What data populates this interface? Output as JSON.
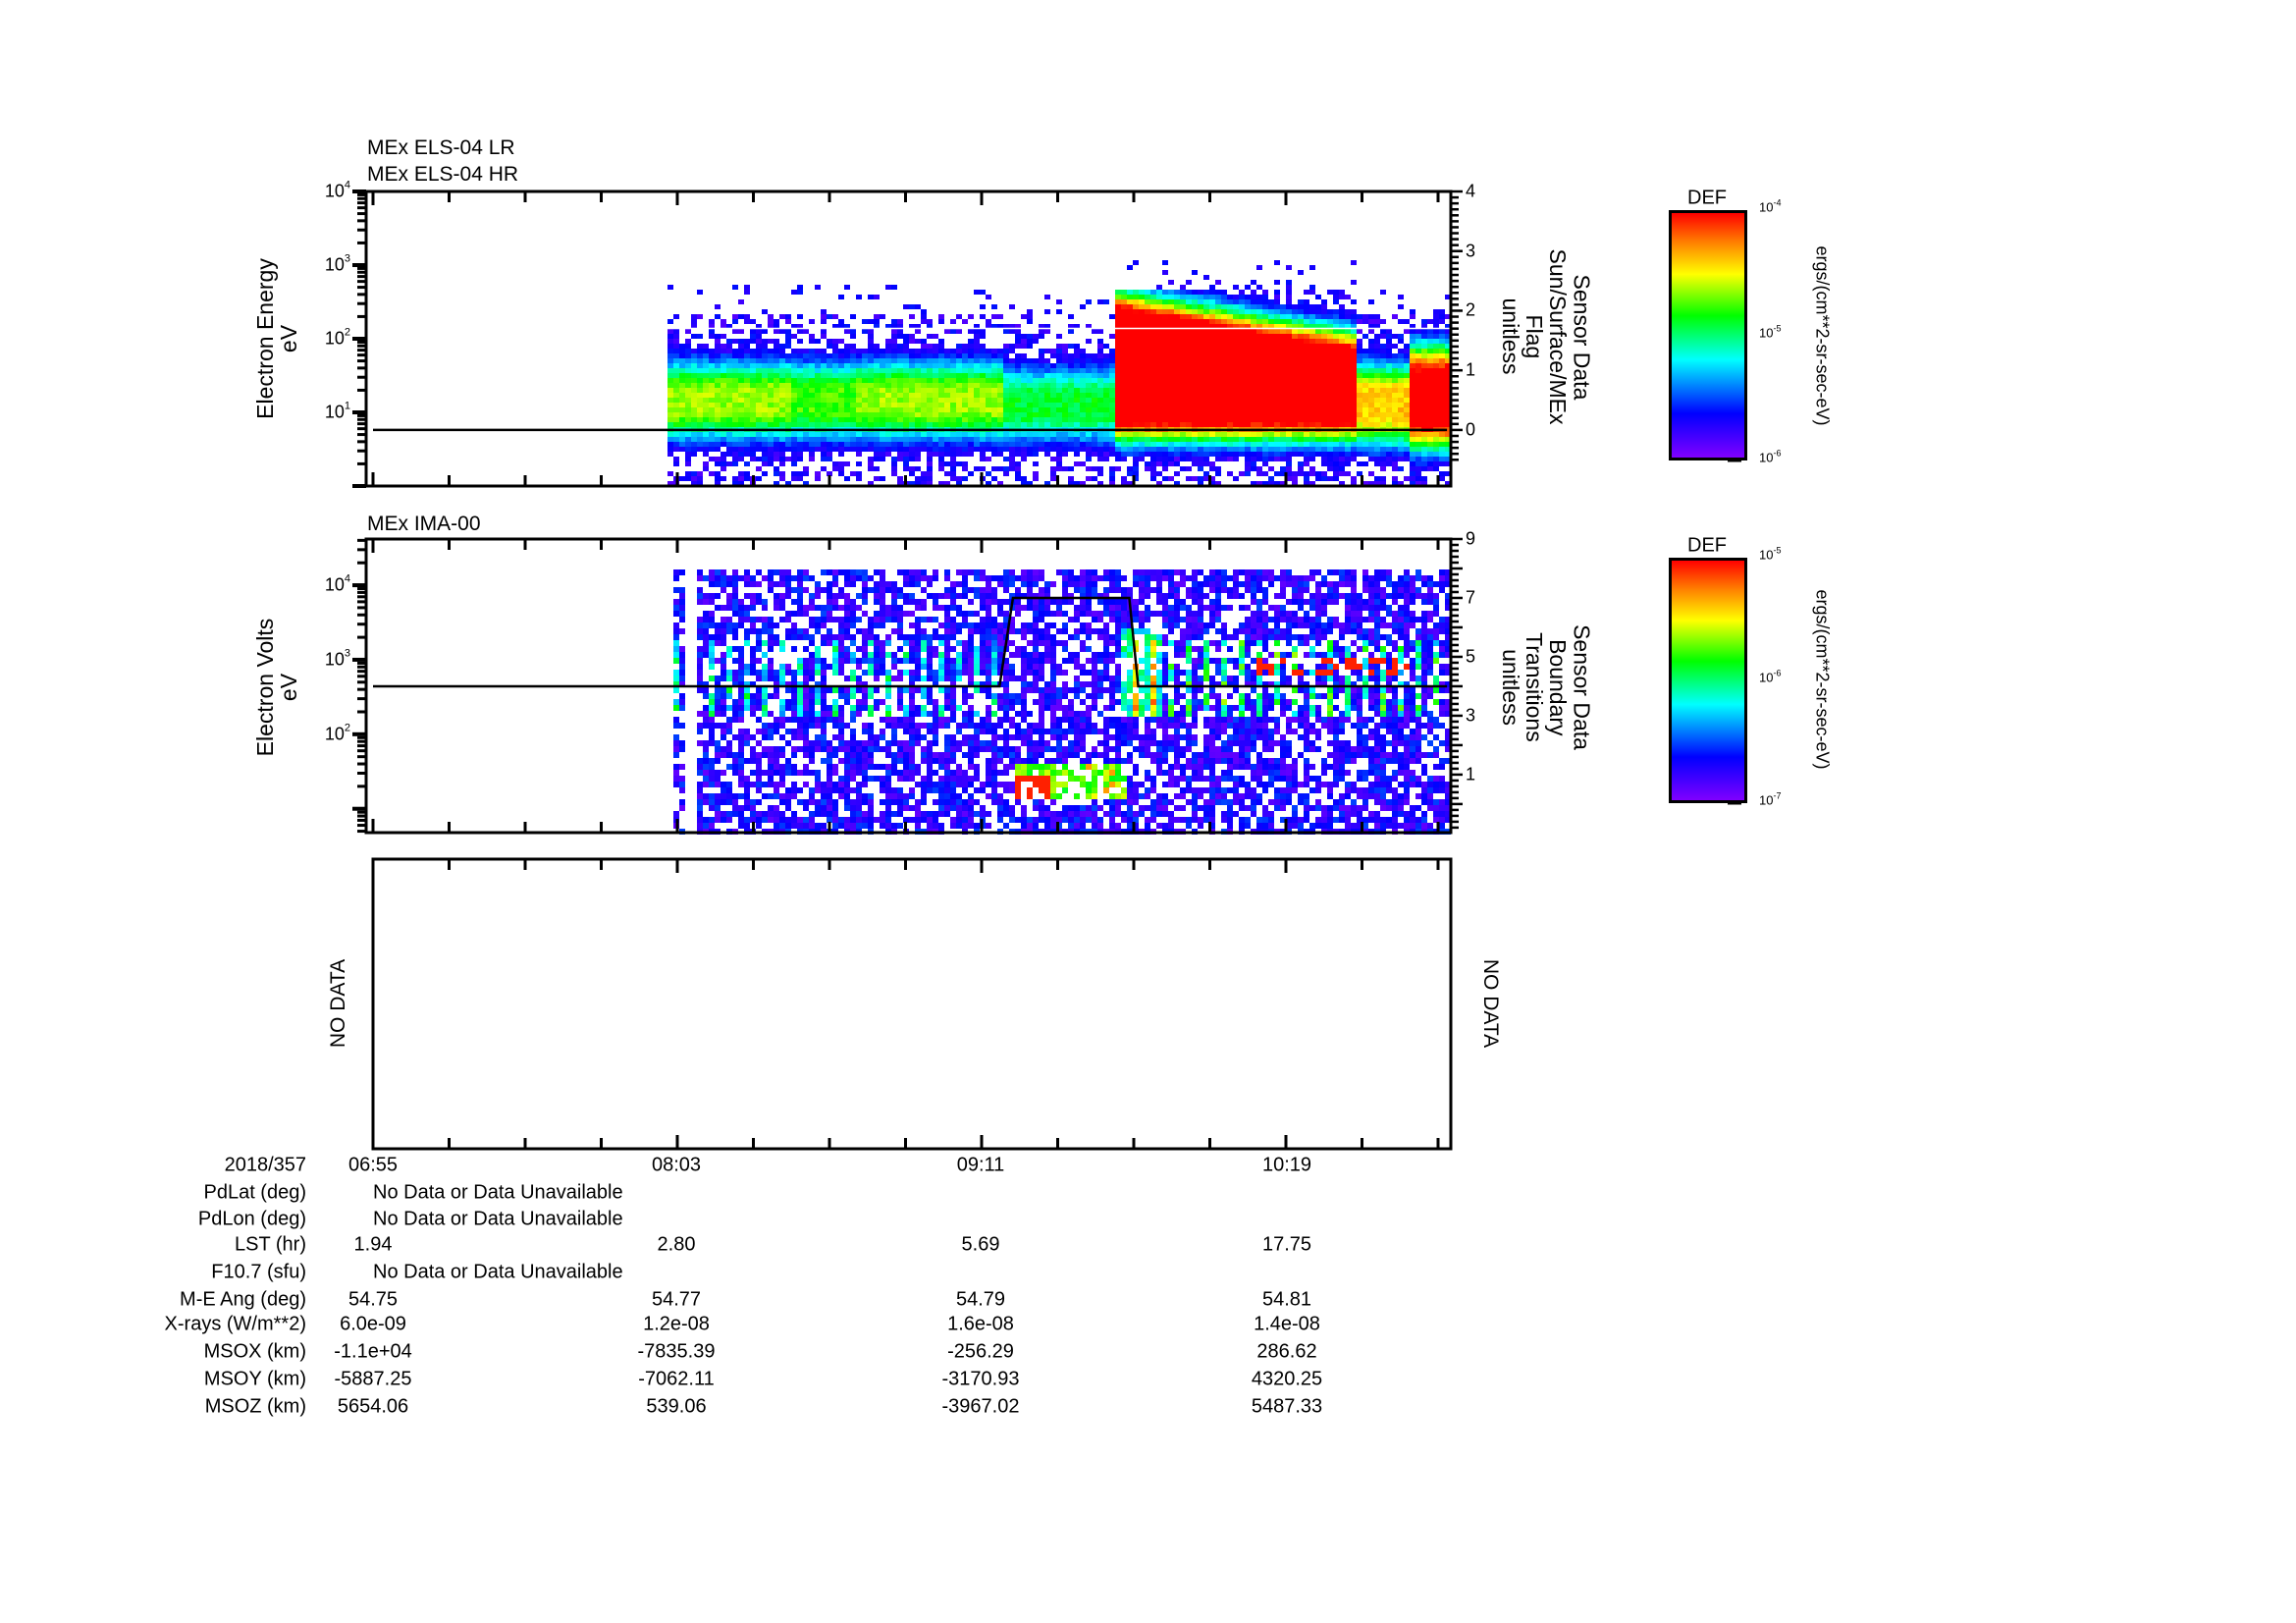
{
  "colormap": [
    "#8000ff",
    "#0000ff",
    "#00ffff",
    "#00ff00",
    "#ffff00",
    "#ff8000",
    "#ff0000"
  ],
  "chart_data": [
    {
      "type": "heatmap",
      "titles": [
        "MEx ELS-04 LR",
        "MEx ELS-04 HR"
      ],
      "ylabel": [
        "Electron Energy",
        "eV"
      ],
      "y_scale": "log",
      "ylim": [
        1,
        10000
      ],
      "y_ticks": [
        {
          "base": "10",
          "exp": "1"
        },
        {
          "base": "10",
          "exp": "2"
        },
        {
          "base": "10",
          "exp": "3"
        },
        {
          "base": "10",
          "exp": "4"
        }
      ],
      "xlim": [
        "06:55",
        "10:55"
      ],
      "x_ticks": [
        "06:55",
        "08:03",
        "09:11",
        "10:19"
      ],
      "right_axis": {
        "label": [
          "Sensor Data",
          "Sun/Surface/MEx",
          "Flag",
          "unitless"
        ],
        "ylim": [
          -0.94,
          4
        ],
        "ticks": [
          "0",
          "1",
          "2",
          "3",
          "4"
        ]
      },
      "overlay": {
        "line_color": "#000000",
        "points": [
          [
            "06:55",
            0
          ],
          [
            "10:55",
            0
          ]
        ]
      },
      "colorbar": {
        "title": "DEF",
        "scale": "log",
        "range": [
          1e-06,
          0.0001
        ],
        "ticks": [
          {
            "base": "10",
            "exp": "-4"
          },
          {
            "base": "10",
            "exp": "-5"
          },
          {
            "base": "10",
            "exp": "-6"
          }
        ],
        "units": "ergs/(cm**2-sr-sec-eV)"
      }
    },
    {
      "type": "heatmap",
      "titles": [
        "MEx IMA-00"
      ],
      "ylabel": [
        "Electron Volts",
        "eV"
      ],
      "y_scale": "log",
      "ylim": [
        4.8,
        41700
      ],
      "y_ticks": [
        {
          "base": "10",
          "exp": "2"
        },
        {
          "base": "10",
          "exp": "3"
        },
        {
          "base": "10",
          "exp": "4"
        }
      ],
      "xlim": [
        "06:55",
        "10:55"
      ],
      "x_ticks": [
        "06:55",
        "08:03",
        "09:11",
        "10:19"
      ],
      "right_axis": {
        "label": [
          "Sensor Data",
          "Boundary",
          "Transitions",
          "unitless"
        ],
        "ylim": [
          -0.97,
          9
        ],
        "ticks": [
          "1",
          "3",
          "5",
          "7",
          "9"
        ]
      },
      "overlay": {
        "line_color": "#000000",
        "points": [
          [
            "06:55",
            4
          ],
          [
            "09:15",
            4
          ],
          [
            "09:18",
            7
          ],
          [
            "09:44",
            7
          ],
          [
            "09:46",
            4
          ],
          [
            "10:55",
            4
          ]
        ]
      },
      "colorbar": {
        "title": "DEF",
        "scale": "log",
        "range": [
          1e-07,
          1e-05
        ],
        "ticks": [
          {
            "base": "10",
            "exp": "-5"
          },
          {
            "base": "10",
            "exp": "-6"
          },
          {
            "base": "10",
            "exp": "-7"
          }
        ],
        "units": "ergs/(cm**2-sr-sec-eV)"
      }
    },
    {
      "type": "line",
      "left_label": "NO DATA",
      "right_label": "NO DATA",
      "xlim": [
        "06:55",
        "10:55"
      ],
      "x_ticks": [
        "06:55",
        "08:03",
        "09:11",
        "10:19"
      ]
    }
  ],
  "ephemeris": {
    "date": "2018/357",
    "times": [
      "06:55",
      "08:03",
      "09:11",
      "10:19"
    ],
    "rows": [
      {
        "label": "PdLat (deg)",
        "message": "No Data or Data Unavailable"
      },
      {
        "label": "PdLon (deg)",
        "message": "No Data or Data Unavailable"
      },
      {
        "label": "LST (hr)",
        "values": [
          "1.94",
          "2.80",
          "5.69",
          "17.75"
        ]
      },
      {
        "label": "F10.7 (sfu)",
        "message": "No Data or Data Unavailable"
      },
      {
        "label": "M-E Ang (deg)",
        "values": [
          "54.75",
          "54.77",
          "54.79",
          "54.81"
        ]
      },
      {
        "label": "X-rays (W/m**2)",
        "values": [
          "6.0e-09",
          "1.2e-08",
          "1.6e-08",
          "1.4e-08"
        ]
      },
      {
        "label": "MSOX (km)",
        "values": [
          "-1.1e+04",
          "-7835.39",
          "-256.29",
          "286.62"
        ]
      },
      {
        "label": "MSOY (km)",
        "values": [
          "-5887.25",
          "-7062.11",
          "-3170.93",
          "4320.25"
        ]
      },
      {
        "label": "MSOZ (km)",
        "values": [
          "5654.06",
          "539.06",
          "-3967.02",
          "5487.33"
        ]
      }
    ]
  }
}
